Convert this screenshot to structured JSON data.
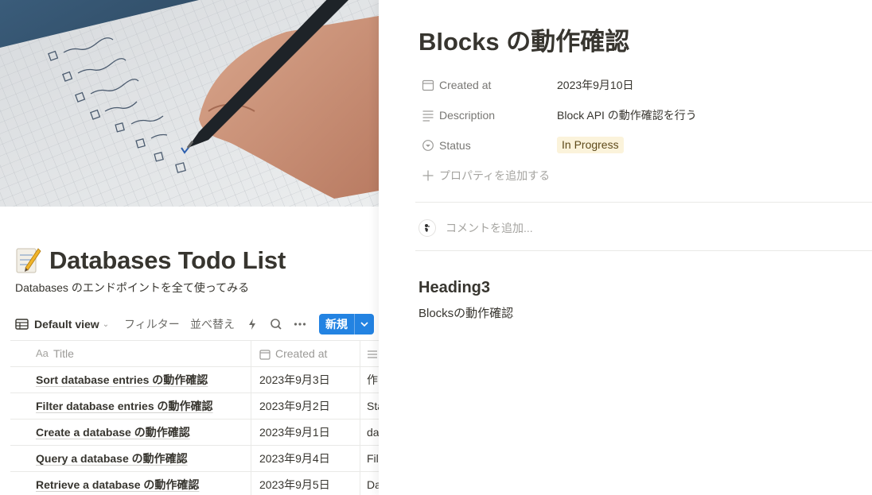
{
  "database": {
    "title": "Databases Todo List",
    "description": "Databases のエンドポイントを全て使ってみる",
    "toolbar": {
      "view_label": "Default view",
      "filter_label": "フィルター",
      "sort_label": "並べ替え",
      "new_label": "新規"
    },
    "columns": {
      "title": "Title",
      "created_at": "Created at"
    },
    "rows": [
      {
        "title": "Sort database entries の動作確認",
        "created_at": "2023年9月3日",
        "third": "作"
      },
      {
        "title": "Filter database entries の動作確認",
        "created_at": "2023年9月2日",
        "third": "Sta"
      },
      {
        "title": "Create a database の動作確認",
        "created_at": "2023年9月1日",
        "third": "da"
      },
      {
        "title": "Query a database の動作確認",
        "created_at": "2023年9月4日",
        "third": "Fil"
      },
      {
        "title": "Retrieve a database の動作確認",
        "created_at": "2023年9月5日",
        "third": "Da"
      }
    ]
  },
  "page": {
    "title": "Blocks の動作確認",
    "properties": [
      {
        "name": "Created at",
        "value": "2023年9月10日",
        "icon": "calendar-icon"
      },
      {
        "name": "Description",
        "value": "Block API の動作確認を行う",
        "icon": "text-lines-icon"
      },
      {
        "name": "Status",
        "value": "In Progress",
        "icon": "status-icon"
      }
    ],
    "add_property_label": "プロパティを追加する",
    "comment_placeholder": "コメントを追加...",
    "heading": "Heading3",
    "paragraph": "Blocksの動作確認"
  },
  "colors": {
    "accent": "#2383e2",
    "status_bg": "#fbf3db",
    "text": "#37352f"
  }
}
